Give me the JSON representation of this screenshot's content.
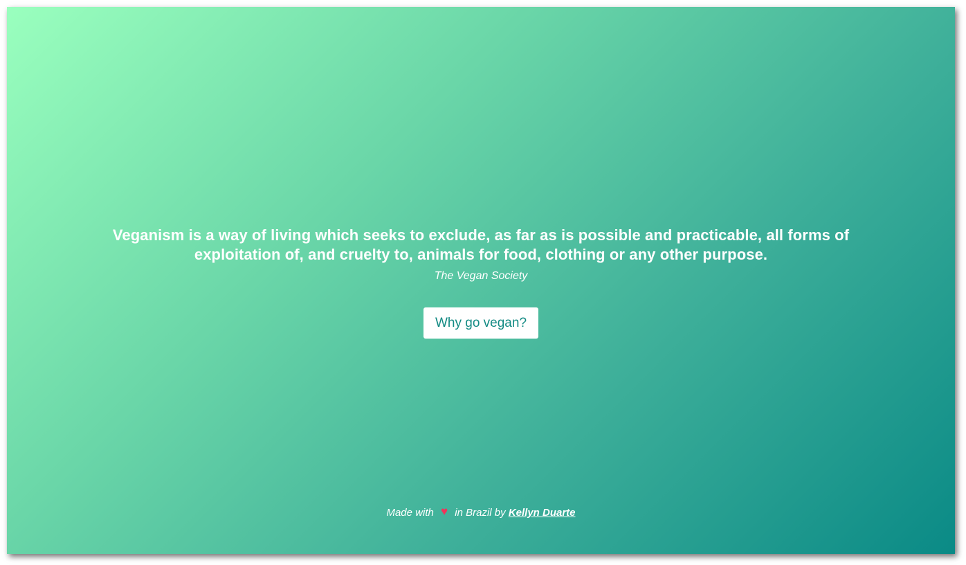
{
  "hero": {
    "quote": "Veganism is a way of living which seeks to exclude, as far as is possible and practicable, all forms of exploitation of, and cruelty to, animals for food, clothing or any other purpose.",
    "author": "The Vegan Society",
    "cta_label": "Why go vegan?"
  },
  "footer": {
    "prefix": "Made with",
    "heart_icon": "heart-icon",
    "middle": "in Brazil by",
    "author_link": "Kellyn Duarte"
  },
  "colors": {
    "gradient_start": "#9affbe",
    "gradient_end": "#0a8a86",
    "button_text": "#148b84",
    "heart": "#f0345a"
  }
}
